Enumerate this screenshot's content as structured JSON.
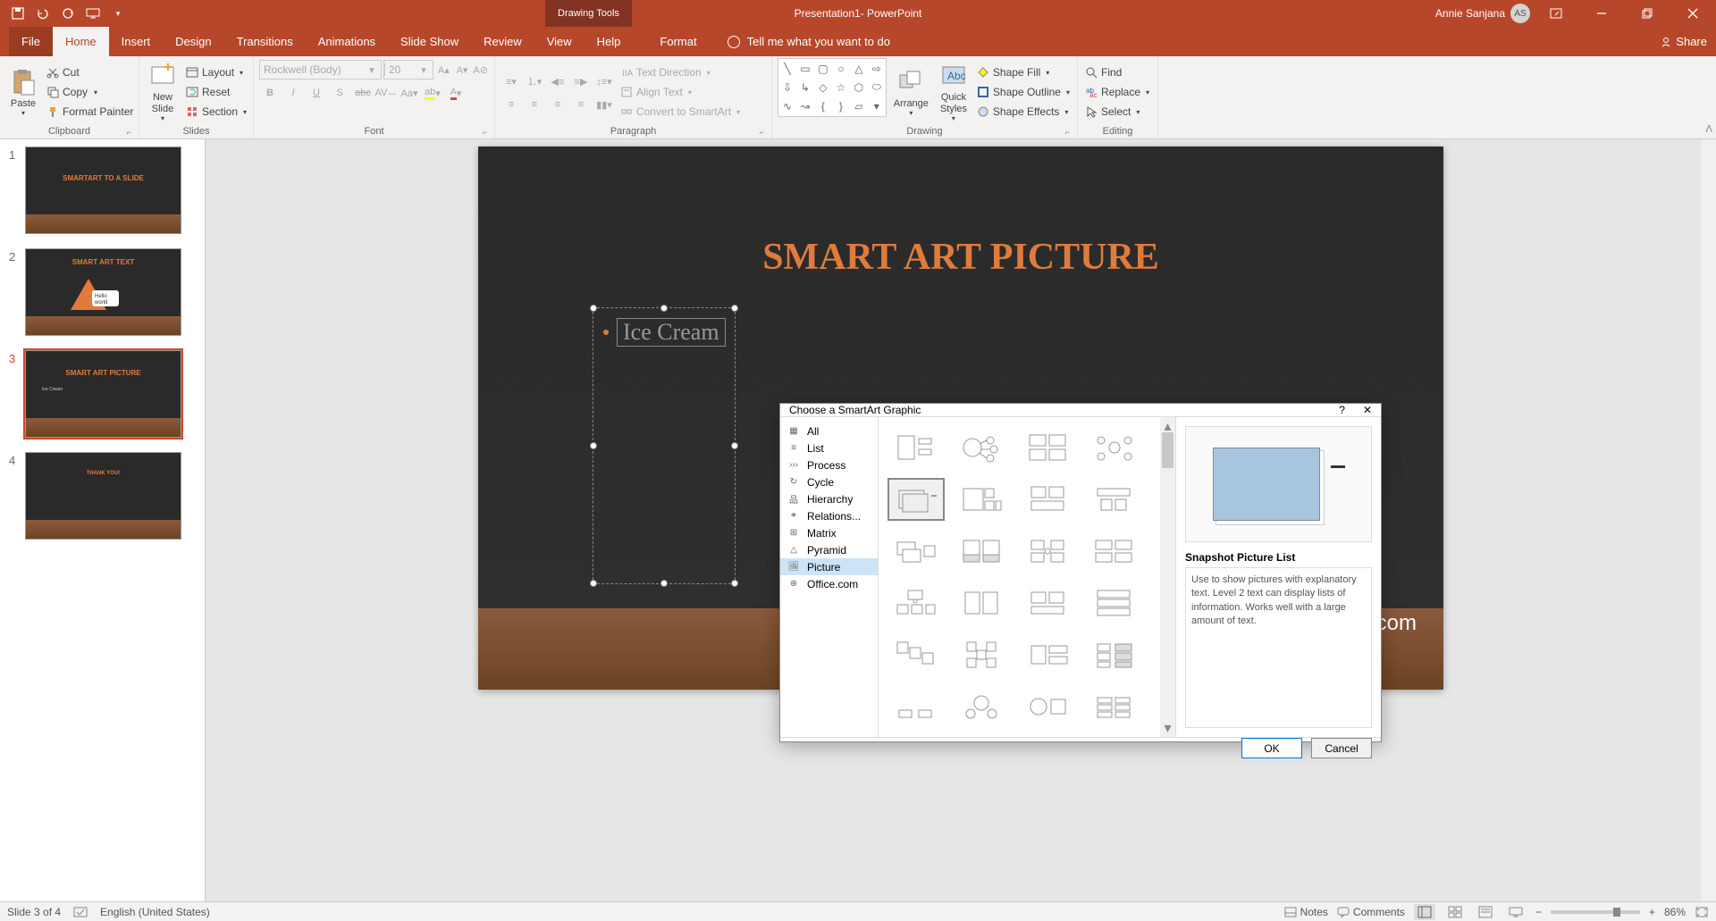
{
  "titlebar": {
    "document": "Presentation1",
    "app": " - PowerPoint",
    "contextTab": "Drawing Tools",
    "user": "Annie Sanjana",
    "initials": "AS"
  },
  "tabs": {
    "file": "File",
    "home": "Home",
    "insert": "Insert",
    "design": "Design",
    "transitions": "Transitions",
    "animations": "Animations",
    "slideshow": "Slide Show",
    "review": "Review",
    "view": "View",
    "help": "Help",
    "format": "Format",
    "tellme": "Tell me what you want to do",
    "share": "Share"
  },
  "ribbon": {
    "clipboard": {
      "label": "Clipboard",
      "paste": "Paste",
      "cut": "Cut",
      "copy": "Copy",
      "formatPainter": "Format Painter"
    },
    "slides": {
      "label": "Slides",
      "newSlide": "New\nSlide",
      "layout": "Layout",
      "reset": "Reset",
      "section": "Section"
    },
    "font": {
      "label": "Font",
      "name": "Rockwell (Body)",
      "size": "20"
    },
    "paragraph": {
      "label": "Paragraph",
      "textDirection": "Text Direction",
      "alignText": "Align Text",
      "convertSmartArt": "Convert to SmartArt"
    },
    "drawing": {
      "label": "Drawing",
      "arrange": "Arrange",
      "quickStyles": "Quick\nStyles",
      "shapeFill": "Shape Fill",
      "shapeOutline": "Shape Outline",
      "shapeEffects": "Shape Effects"
    },
    "editing": {
      "label": "Editing",
      "find": "Find",
      "replace": "Replace",
      "select": "Select"
    }
  },
  "thumbnails": [
    {
      "num": "1",
      "text": "SMARTART TO A SLIDE"
    },
    {
      "num": "2",
      "text": "SMART ART TEXT"
    },
    {
      "num": "3",
      "text": "SMART ART PICTURE"
    },
    {
      "num": "4",
      "text": "THANK YOU!"
    }
  ],
  "slide": {
    "title": "SMART ART PICTURE",
    "bullet": "Ice Cream",
    "watermark": "developerpublish.com"
  },
  "dialog": {
    "title": "Choose a SmartArt Graphic",
    "categories": {
      "all": "All",
      "list": "List",
      "process": "Process",
      "cycle": "Cycle",
      "hierarchy": "Hierarchy",
      "relationship": "Relations...",
      "matrix": "Matrix",
      "pyramid": "Pyramid",
      "picture": "Picture",
      "office": "Office.com"
    },
    "preview": {
      "title": "Snapshot Picture List",
      "desc": "Use to show pictures with explanatory text. Level 2 text can display lists of information. Works well with a large amount of  text."
    },
    "ok": "OK",
    "cancel": "Cancel"
  },
  "status": {
    "slideOf": "Slide 3 of 4",
    "language": "English (United States)",
    "notes": "Notes",
    "comments": "Comments",
    "zoom": "86%"
  }
}
